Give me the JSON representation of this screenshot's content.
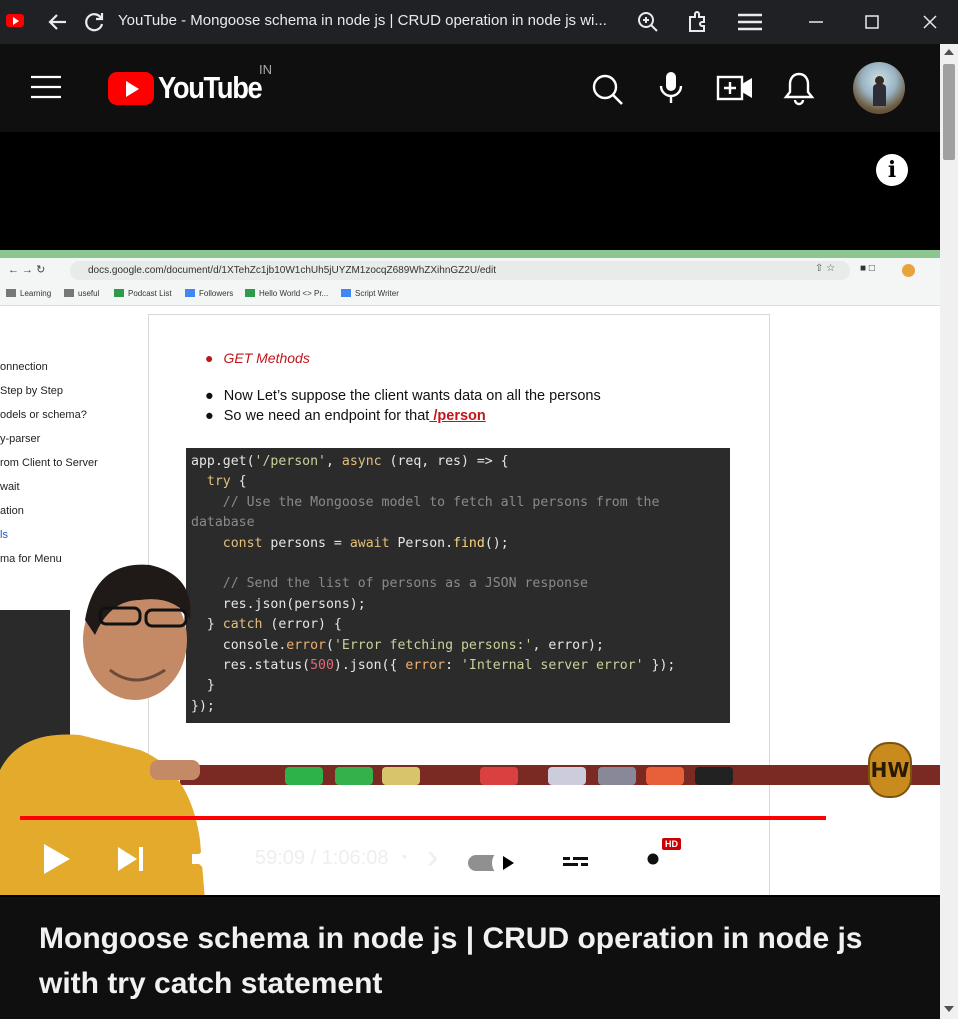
{
  "window": {
    "title": "YouTube - Mongoose schema in node js | CRUD operation in node js wi...",
    "icons": [
      "back-arrow-icon",
      "reload-icon",
      "zoom-icon",
      "extensions-icon",
      "menu-icon",
      "minimize-icon",
      "maximize-icon",
      "close-icon"
    ]
  },
  "header": {
    "logo_text": "YouTube",
    "country_code": "IN",
    "icons": [
      "hamburger-menu-icon",
      "search-icon",
      "microphone-icon",
      "create-video-icon",
      "notifications-bell-icon",
      "avatar"
    ]
  },
  "video": {
    "browser_url": "docs.google.com/document/d/1XTehZc1jb10W1chUh5jUYZM1zocqZ689WhZXihnGZ2U/edit",
    "bookmarks": [
      "Learning",
      "useful",
      "Podcast List",
      "Followers",
      "Hello World <> Pr...",
      "Script Writer"
    ],
    "outline": [
      "onnection",
      "Step by Step",
      "odels or schema?",
      "y-parser",
      "rom Client to Server",
      "wait",
      "ation",
      "ls",
      "ma for Menu"
    ],
    "doc": {
      "heading": "GET Methods",
      "line1": "Now Let’s suppose the client wants data on all the persons",
      "line2_prefix": "So we need an endpoint for that",
      "line2_link": " /person"
    },
    "watermark": "HW"
  },
  "controls": {
    "current_time": "59:09",
    "separator": " / ",
    "duration": "1:06:08",
    "dot": "•",
    "chevron": "›",
    "hd_badge": "HD",
    "progress": 0.895,
    "icons": [
      "play-icon",
      "next-icon",
      "volume-icon",
      "autoplay-toggle",
      "subtitles-icon",
      "settings-icon",
      "miniplayer-icon",
      "theater-mode-icon",
      "fullscreen-icon"
    ]
  },
  "colors": {
    "accent": "#ff0000",
    "background": "#0f0f0f"
  },
  "video_title": "Mongoose schema in node js | CRUD operation in node js with try catch statement"
}
